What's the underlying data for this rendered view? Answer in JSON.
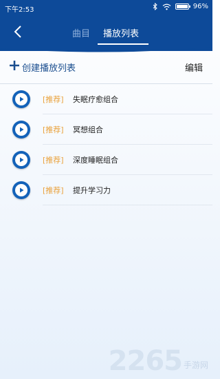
{
  "status_bar": {
    "time": "下午2:53",
    "battery": "96%"
  },
  "header": {
    "tabs": [
      {
        "label": "曲目",
        "active": false
      },
      {
        "label": "播放列表",
        "active": true
      }
    ]
  },
  "actions": {
    "create_label": "创建播放列表",
    "edit_label": "编辑"
  },
  "playlists": [
    {
      "tag": "[推荐]",
      "title": "失眠疗愈组合"
    },
    {
      "tag": "[推荐]",
      "title": "冥想组合"
    },
    {
      "tag": "[推荐]",
      "title": "深度睡眠组合"
    },
    {
      "tag": "[推荐]",
      "title": "提升学习力"
    }
  ],
  "watermark": {
    "number": "2265",
    "text": "手游网"
  },
  "colors": {
    "brand": "#0d4a99",
    "play": "#1362b9",
    "tag": "#e9a13b"
  }
}
